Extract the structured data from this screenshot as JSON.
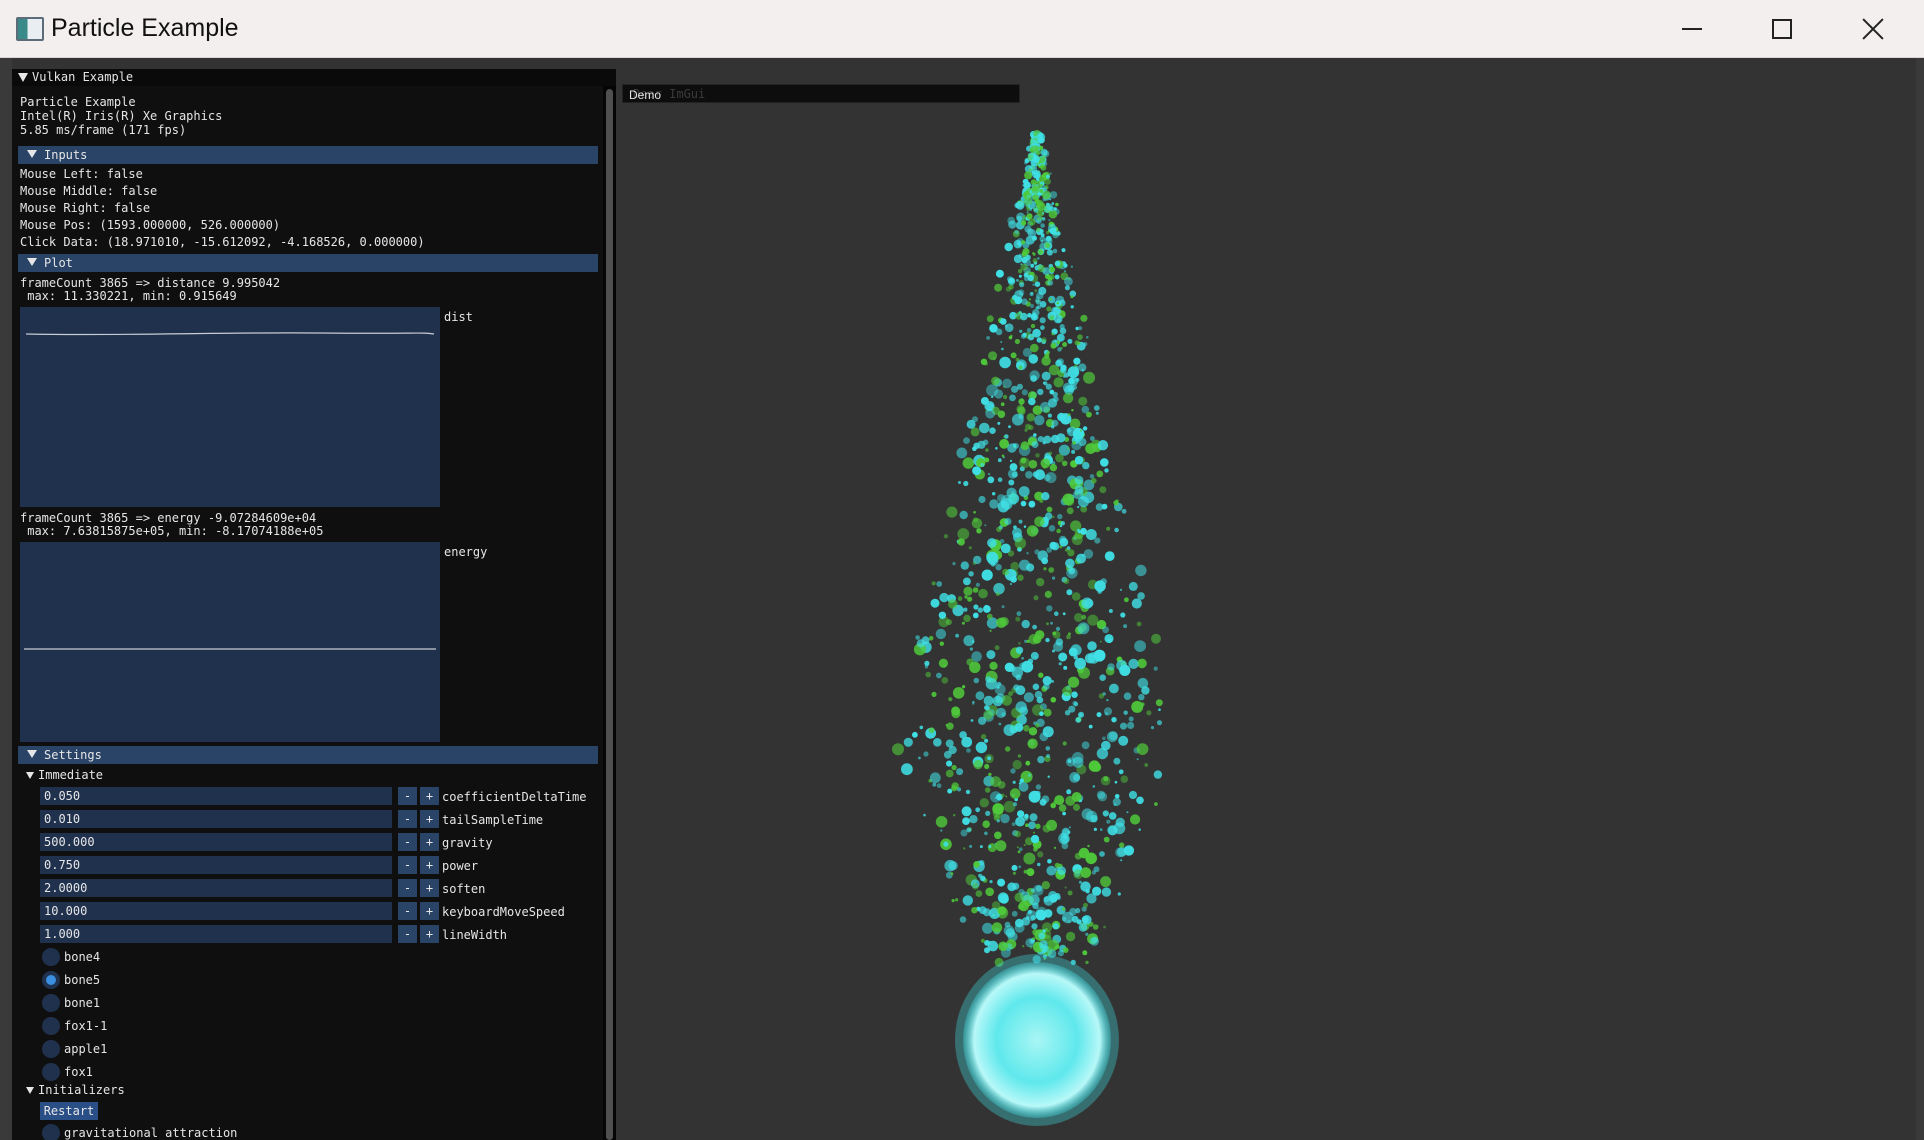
{
  "window": {
    "title": "Particle Example",
    "minimize_icon": "minimize-icon",
    "maximize_icon": "maximize-icon",
    "close_icon": "close-icon"
  },
  "imgui": {
    "window_title": "Vulkan Example",
    "app_name": "Particle Example",
    "device": "Intel(R) Iris(R) Xe Graphics",
    "fps": "5.85 ms/frame (171 fps)",
    "inputs": {
      "header": "Inputs",
      "mouse_left": "Mouse Left: false",
      "mouse_middle": "Mouse Middle: false",
      "mouse_right": "Mouse Right: false",
      "mouse_pos": "Mouse Pos: (1593.000000, 526.000000)",
      "click_data": "Click Data: (18.971010, -15.612092, -4.168526, 0.000000)"
    },
    "plot": {
      "header": "Plot",
      "dist_line1": "frameCount 3865 => distance 9.995042",
      "dist_line2": " max: 11.330221, min: 0.915649",
      "dist_label": "dist",
      "energy_line1": "frameCount 3865 => energy -9.07284609e+04",
      "energy_line2": " max: 7.63815875e+05, min: -8.17074188e+05",
      "energy_label": "energy"
    },
    "settings": {
      "header": "Settings",
      "immediate_label": "Immediate",
      "fields": [
        {
          "value": "0.050",
          "label": "coefficientDeltaTime"
        },
        {
          "value": "0.010",
          "label": "tailSampleTime"
        },
        {
          "value": "500.000",
          "label": "gravity"
        },
        {
          "value": "0.750",
          "label": "power"
        },
        {
          "value": "2.0000",
          "label": "soften"
        },
        {
          "value": "10.000",
          "label": "keyboardMoveSpeed"
        },
        {
          "value": "1.000",
          "label": "lineWidth"
        }
      ],
      "minus": "-",
      "plus": "+",
      "radios": [
        {
          "label": "bone4",
          "selected": false
        },
        {
          "label": "bone5",
          "selected": true
        },
        {
          "label": "bone1",
          "selected": false
        },
        {
          "label": "fox1-1",
          "selected": false
        },
        {
          "label": "apple1",
          "selected": false
        },
        {
          "label": "fox1",
          "selected": false
        }
      ],
      "initializers_label": "Initializers",
      "restart_label": "Restart",
      "gravitational_label": "gravitational attraction"
    }
  },
  "demo_window": {
    "dim_text": "Dear ImGui",
    "label": "Demo"
  },
  "colors": {
    "panel_bg": "#0f0f0f",
    "header_bg": "#2a4468",
    "frame_bg": "#20314d",
    "viewport_bg": "#333333",
    "particle_cyan": "#3fe0e6",
    "particle_green": "#4fc93a"
  }
}
